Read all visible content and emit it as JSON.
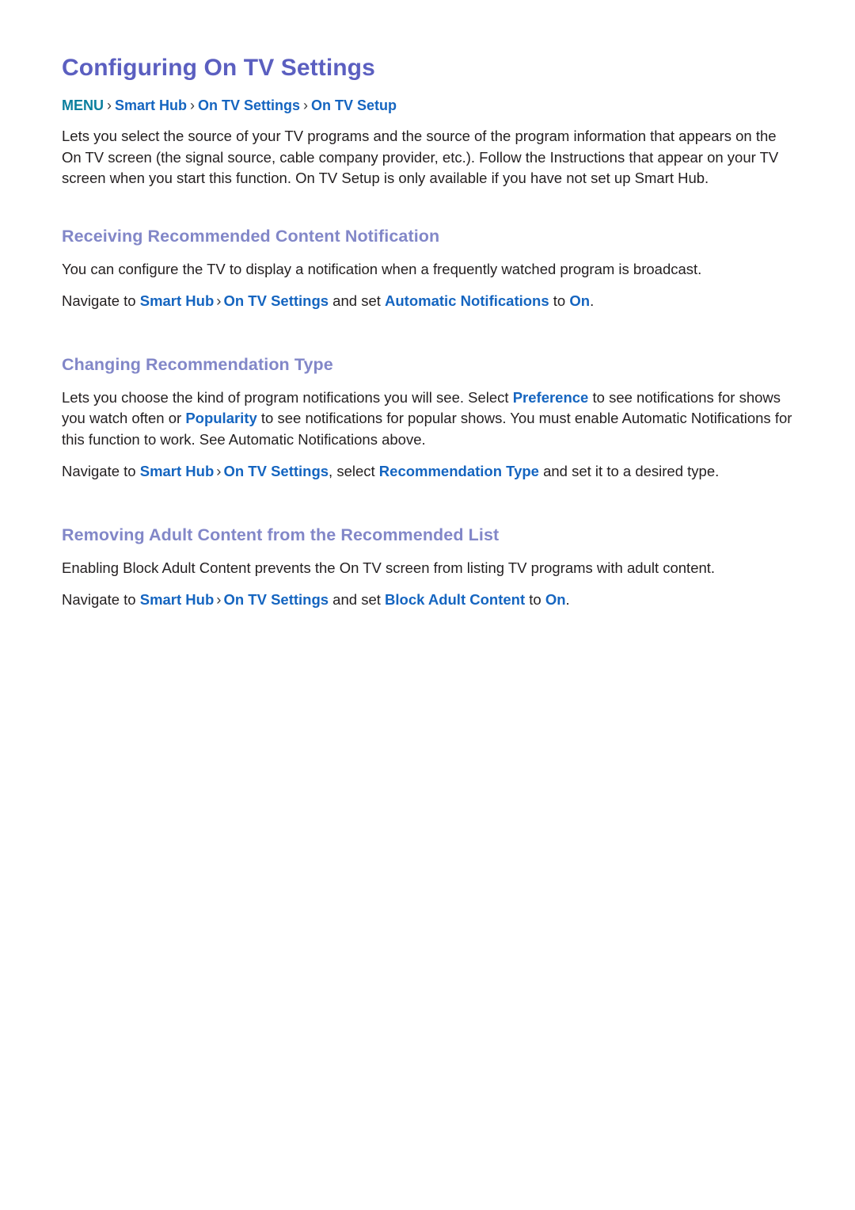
{
  "document": {
    "title": "Configuring On TV Settings",
    "breadcrumb": {
      "separator": "›",
      "items": [
        {
          "label": "MENU",
          "style": "menu"
        },
        {
          "label": "Smart Hub",
          "style": "link"
        },
        {
          "label": "On TV Settings",
          "style": "link"
        },
        {
          "label": "On TV Setup",
          "style": "link"
        }
      ]
    },
    "intro_paragraph": "Lets you select the source of your TV programs and the source of the program information that appears on the On TV screen (the signal source, cable company provider, etc.). Follow the Instructions that appear on your TV screen when you start this function. On TV Setup is only available if you have not set up Smart Hub.",
    "sections": [
      {
        "heading": "Receiving Recommended Content Notification",
        "body_text": "You can configure the TV to display a notification when a frequently watched program is broadcast.",
        "nav_line": {
          "prefix": "Navigate to ",
          "link1": "Smart Hub",
          "separator": "›",
          "link2": "On TV Settings",
          "middle": " and set ",
          "link3": "Automatic Notifications",
          "connector": " to ",
          "link4": "On",
          "suffix": "."
        }
      },
      {
        "heading": "Changing Recommendation Type",
        "body_part1": "Lets you choose the kind of program notifications you will see. Select ",
        "body_link1": "Preference",
        "body_part2": " to see notifications for shows you watch often or ",
        "body_link2": "Popularity",
        "body_part3": " to see notifications for popular shows. You must enable Automatic Notifications for this function to work. See Automatic Notifications above.",
        "nav_line": {
          "prefix": "Navigate to ",
          "link1": "Smart Hub",
          "separator": "›",
          "link2": "On TV Settings",
          "middle": ", select ",
          "link3": "Recommendation Type",
          "connector": " and set it to a desired type",
          "suffix": "."
        }
      },
      {
        "heading": "Removing Adult Content from the Recommended List",
        "body_text": "Enabling Block Adult Content prevents the On TV screen from listing TV programs with adult content.",
        "nav_line": {
          "prefix": "Navigate to ",
          "link1": "Smart Hub",
          "separator": "›",
          "link2": "On TV Settings",
          "middle": " and set ",
          "link3": "Block Adult Content",
          "connector": " to ",
          "link4": "On",
          "suffix": "."
        }
      }
    ],
    "colors": {
      "title": "#5b5fc0",
      "section_heading": "#8287c8",
      "link": "#1565c0",
      "menu_accent": "#0b7f9e",
      "body_text": "#231f20",
      "background": "#ffffff"
    }
  }
}
